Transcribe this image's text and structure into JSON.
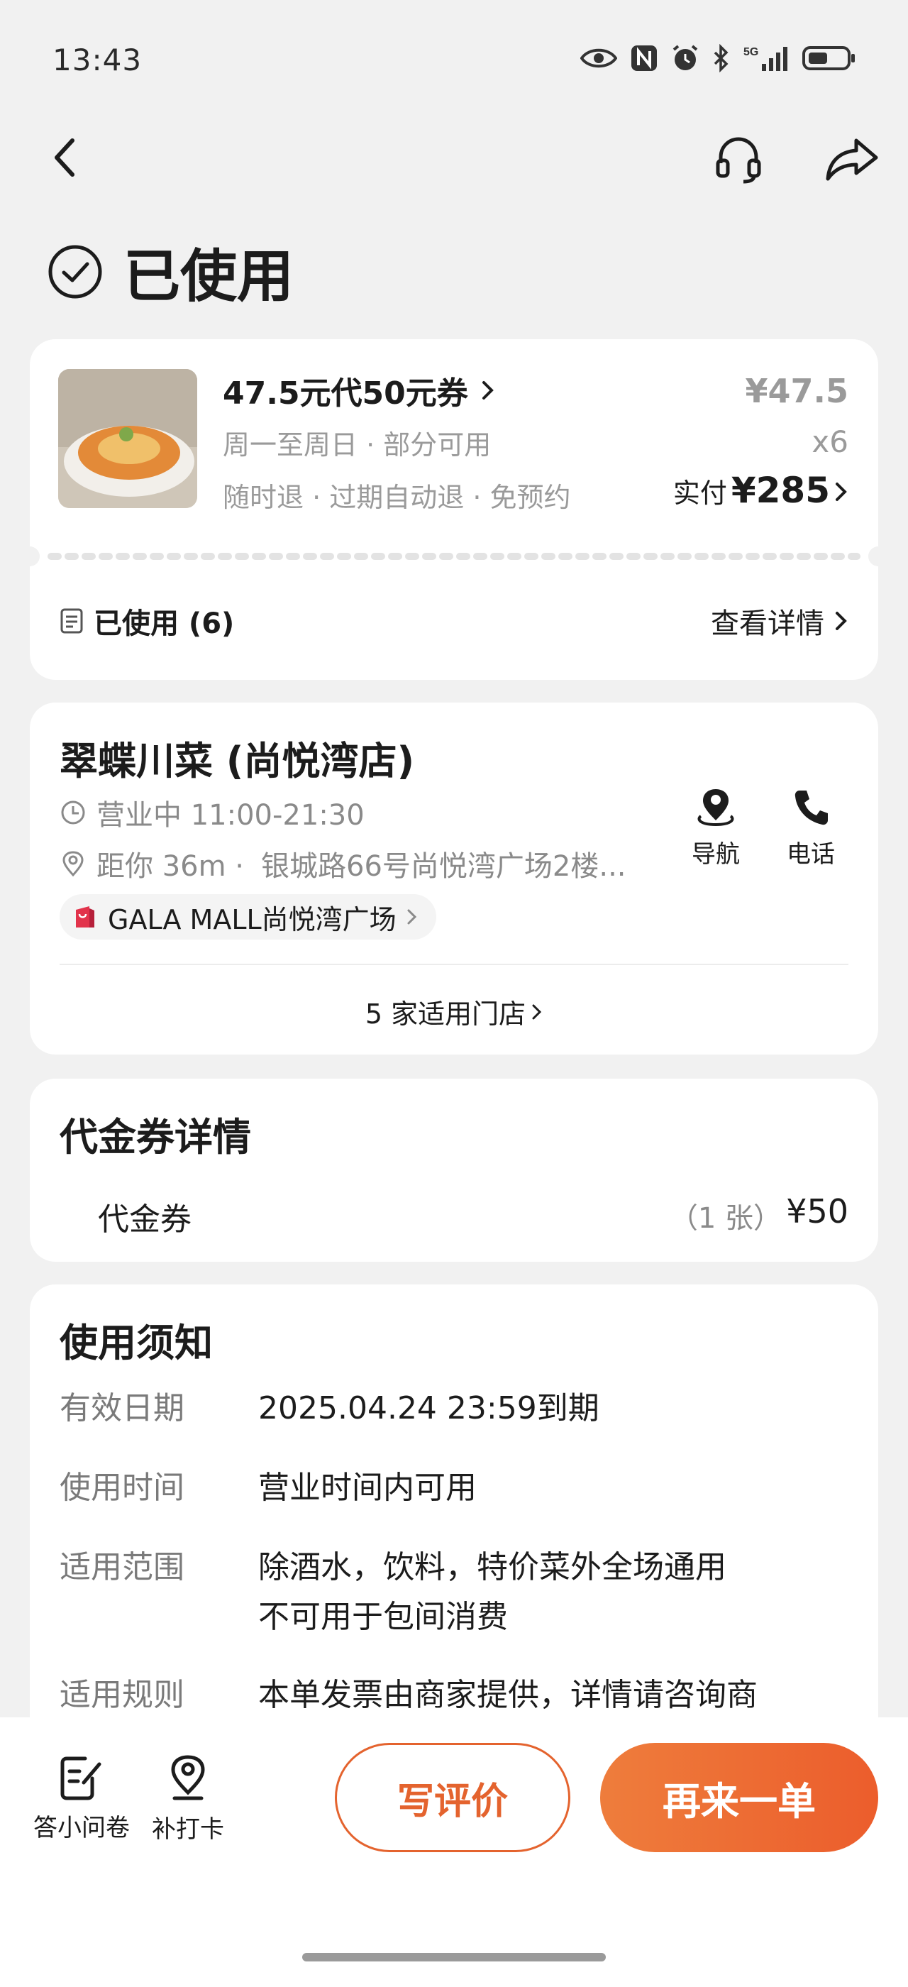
{
  "status_bar": {
    "time": "13:43",
    "icons": [
      "eye-icon",
      "nfc-icon",
      "alarm-icon",
      "bluetooth-icon",
      "5g-signal-icon",
      "battery-icon"
    ]
  },
  "nav": {
    "icons": [
      "back-icon",
      "headset-icon",
      "share-icon"
    ]
  },
  "order_status": "已使用",
  "order": {
    "title": "47.5元代50元券",
    "usage_days": "周一至周日 · 部分可用",
    "policies": "随时退 · 过期自动退 · 免预约",
    "unit_price": "¥47.5",
    "quantity": "x6",
    "paid_label": "实付",
    "paid_amount": "¥285",
    "used_label": "已使用 (6)",
    "detail_link": "查看详情"
  },
  "shop": {
    "name": "翠蝶川菜 (尚悦湾店)",
    "hours": "营业中 11:00-21:30",
    "distance": "距你 36m ·",
    "address": "银城路66号尚悦湾广场2楼...",
    "mall": "GALA MALL尚悦湾广场",
    "nav_label": "导航",
    "phone_label": "电话",
    "stores_link": "5 家适用门店"
  },
  "voucher": {
    "section_title": "代金券详情",
    "name": "代金券",
    "count": "（1 张）",
    "value": "¥50"
  },
  "notice": {
    "section_title": "使用须知",
    "rows": [
      {
        "key": "有效日期",
        "lines": [
          "2025.04.24 23:59到期"
        ]
      },
      {
        "key": "使用时间",
        "lines": [
          "营业时间内可用"
        ]
      },
      {
        "key": "适用范围",
        "lines": [
          "除酒水，饮料，特价菜外全场通用",
          "不可用于包间消费"
        ]
      },
      {
        "key": "适用规则",
        "lines": [
          "本单发票由商家提供，详情请咨询商"
        ]
      }
    ]
  },
  "bottom_bar": {
    "survey_label": "答小问卷",
    "checkin_label": "补打卡",
    "review_button": "写评价",
    "reorder_button": "再来一单"
  },
  "colors": {
    "accent": "#EC5D2C",
    "page_bg": "#F1F1F1",
    "card_bg": "#FFFFFF",
    "mall_icon": "#E2334B"
  }
}
